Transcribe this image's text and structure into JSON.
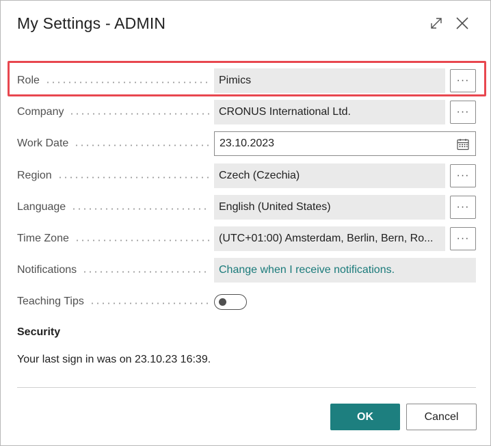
{
  "dialog": {
    "title": "My Settings - ADMIN"
  },
  "fields": {
    "role": {
      "label": "Role",
      "value": "Pimics",
      "assist": "···"
    },
    "company": {
      "label": "Company",
      "value": "CRONUS International Ltd.",
      "assist": "···"
    },
    "work_date": {
      "label": "Work Date",
      "value": "23.10.2023"
    },
    "region": {
      "label": "Region",
      "value": "Czech (Czechia)",
      "assist": "···"
    },
    "language": {
      "label": "Language",
      "value": "English (United States)",
      "assist": "···"
    },
    "time_zone": {
      "label": "Time Zone",
      "value": "(UTC+01:00) Amsterdam, Berlin, Bern, Ro...",
      "assist": "···"
    },
    "notifications": {
      "label": "Notifications",
      "value": "Change when I receive notifications."
    },
    "teaching_tips": {
      "label": "Teaching Tips",
      "enabled": false
    }
  },
  "security": {
    "title": "Security",
    "last_sign_in": "Your last sign in was on 23.10.23 16:39."
  },
  "buttons": {
    "ok": "OK",
    "cancel": "Cancel"
  },
  "icons": {
    "expand": "expand-icon",
    "close": "close-icon",
    "calendar": "calendar-icon"
  },
  "colors": {
    "accent": "#1d7f7f",
    "link": "#1a7a7a",
    "highlight": "#e8474f",
    "field_bg": "#eaeaea"
  }
}
